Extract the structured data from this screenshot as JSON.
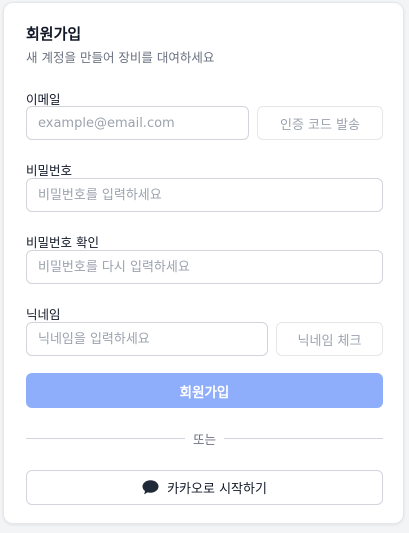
{
  "header": {
    "title": "회원가입",
    "subtitle": "새 계정을 만들어 장비를 대여하세요"
  },
  "email": {
    "label": "이메일",
    "value": "",
    "placeholder": "example@email.com",
    "send_code_label": "인증 코드 발송"
  },
  "password": {
    "label": "비밀번호",
    "value": "",
    "placeholder": "비밀번호를 입력하세요"
  },
  "password_confirm": {
    "label": "비밀번호 확인",
    "value": "",
    "placeholder": "비밀번호를 다시 입력하세요"
  },
  "nickname": {
    "label": "닉네임",
    "value": "",
    "placeholder": "닉네임을 입력하세요",
    "check_label": "닉네임 체크"
  },
  "submit": {
    "label": "회원가입"
  },
  "divider": {
    "text": "또는"
  },
  "kakao": {
    "label": "카카오로 시작하기",
    "icon": "speech-bubble-icon"
  },
  "colors": {
    "primary_disabled": "#8eaefc",
    "border": "#d1d5db",
    "placeholder": "#9ca3af"
  }
}
